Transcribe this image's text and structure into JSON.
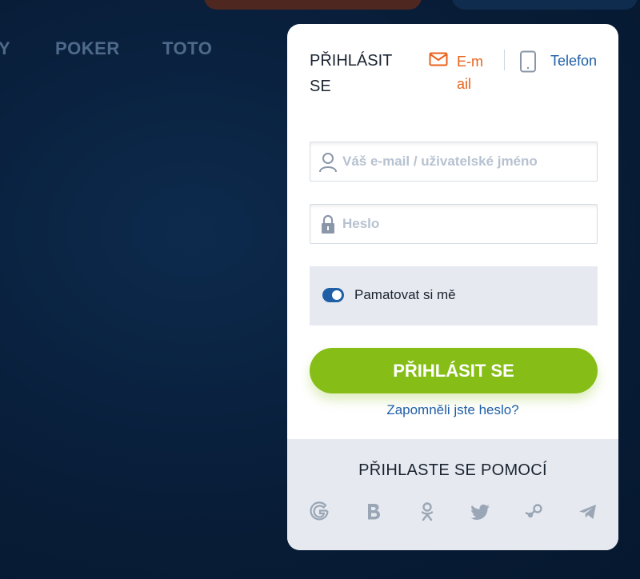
{
  "nav": {
    "items": [
      "Y",
      "POKER",
      "TOTO"
    ]
  },
  "login": {
    "title": "PŘIHLÁSIT SE",
    "methods": {
      "email": "E-mail",
      "phone": "Telefon"
    },
    "email_placeholder": "Váš e-mail / uživatelské jméno",
    "password_placeholder": "Heslo",
    "remember_label": "Pamatovat si mě",
    "remember_on": true,
    "submit_label": "PŘIHLÁSIT SE",
    "forgot_label": "Zapomněli jste heslo?",
    "social_title": "PŘIHLASTE SE POMOCÍ",
    "social_icons": [
      "google-icon",
      "vk-icon",
      "odnoklassniki-icon",
      "twitter-icon",
      "steam-icon",
      "telegram-icon"
    ]
  },
  "colors": {
    "accent_green": "#86be17",
    "email_orange": "#e8621a",
    "link_blue": "#1f5fa6",
    "background_navy": "#081d38"
  }
}
